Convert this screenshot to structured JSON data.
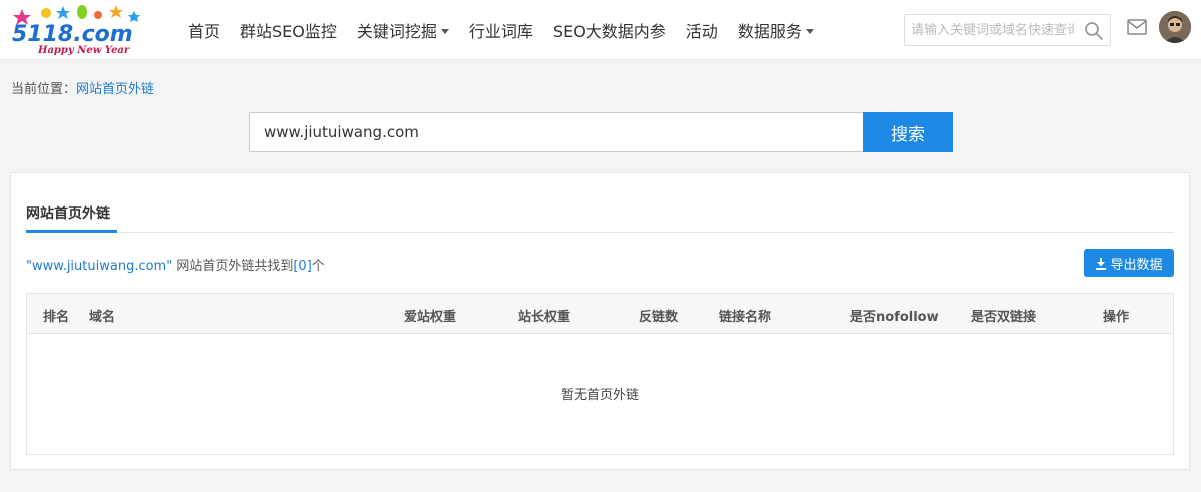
{
  "header": {
    "logo": {
      "text": "5118.com",
      "tagline": "Happy New Year"
    },
    "nav": [
      {
        "label": "首页",
        "dropdown": false
      },
      {
        "label": "群站SEO监控",
        "dropdown": false
      },
      {
        "label": "关键词挖掘",
        "dropdown": true
      },
      {
        "label": "行业词库",
        "dropdown": false
      },
      {
        "label": "SEO大数据内参",
        "dropdown": false
      },
      {
        "label": "活动",
        "dropdown": false
      },
      {
        "label": "数据服务",
        "dropdown": true
      }
    ],
    "search_placeholder": "请输入关键词或域名快速查询",
    "icons": [
      "search-icon",
      "mail-icon",
      "avatar"
    ]
  },
  "breadcrumb": {
    "prefix": "当前位置：",
    "current": "网站首页外链"
  },
  "main_search": {
    "value": "www.jiutuiwang.com",
    "button": "搜索"
  },
  "panel": {
    "tab": "网站首页外链",
    "summary": {
      "q1": "\"",
      "domain": "www.jiutuiwang.com",
      "q2": "\"",
      "text": " 网站首页外链共找到",
      "open": "[",
      "count": "0",
      "close": "]",
      "suffix": "个"
    },
    "export_label": "导出数据",
    "columns": [
      "排名",
      "域名",
      "爱站权重",
      "站长权重",
      "反链数",
      "链接名称",
      "是否nofollow",
      "是否双链接",
      "操作"
    ],
    "empty_text": "暂无首页外链"
  },
  "colors": {
    "accent": "#1e88e5",
    "link": "#1f7ad1"
  }
}
